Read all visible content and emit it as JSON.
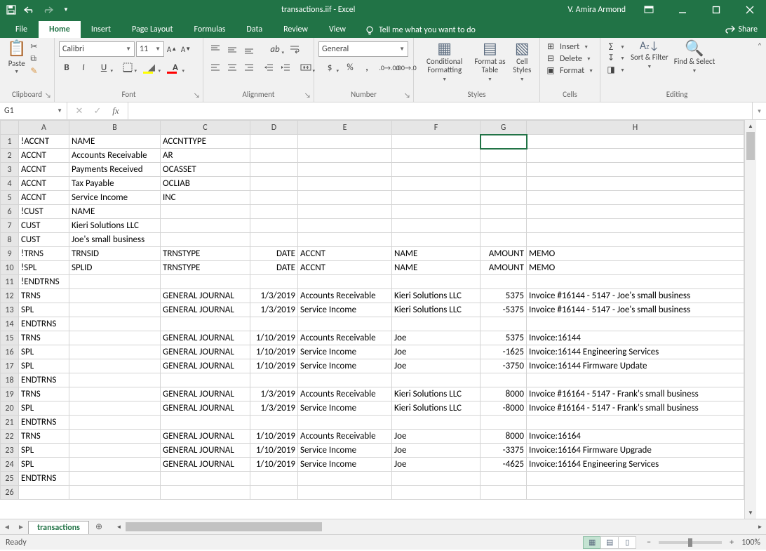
{
  "app": {
    "title": "transactions.iif  -  Excel",
    "user": "V. Amira Armond"
  },
  "tabs": {
    "file": "File",
    "home": "Home",
    "insert": "Insert",
    "page_layout": "Page Layout",
    "formulas": "Formulas",
    "data": "Data",
    "review": "Review",
    "view": "View",
    "tell": "Tell me what you want to do",
    "share": "Share"
  },
  "ribbon": {
    "clipboard": {
      "paste": "Paste",
      "label": "Clipboard"
    },
    "font": {
      "name": "Calibri",
      "size": "11",
      "label": "Font",
      "bold": "B",
      "italic": "I",
      "underline": "U"
    },
    "alignment": {
      "label": "Alignment",
      "wrap": "Wrap Text",
      "merge": "Merge & Center"
    },
    "number": {
      "format": "General",
      "label": "Number"
    },
    "styles": {
      "cond": "Conditional Formatting",
      "fast": "Format as Table",
      "cstyles": "Cell Styles",
      "label": "Styles"
    },
    "cells": {
      "insert": "Insert",
      "delete": "Delete",
      "format": "Format",
      "label": "Cells"
    },
    "editing": {
      "sort": "Sort & Filter",
      "find": "Find & Select",
      "label": "Editing"
    }
  },
  "namebox": "G1",
  "sheet_tab": "transactions",
  "status": {
    "ready": "Ready",
    "zoom": "100%"
  },
  "columns": [
    "A",
    "B",
    "C",
    "D",
    "E",
    "F",
    "G",
    "H"
  ],
  "rows": [
    {
      "n": 1,
      "A": "!ACCNT",
      "B": "NAME",
      "C": "ACCNTTYPE"
    },
    {
      "n": 2,
      "A": "ACCNT",
      "B": "Accounts Receivable",
      "C": "AR"
    },
    {
      "n": 3,
      "A": "ACCNT",
      "B": "Payments Received",
      "C": "OCASSET"
    },
    {
      "n": 4,
      "A": "ACCNT",
      "B": "Tax Payable",
      "C": "OCLIAB"
    },
    {
      "n": 5,
      "A": "ACCNT",
      "B": "Service Income",
      "C": "INC"
    },
    {
      "n": 6,
      "A": "!CUST",
      "B": "NAME"
    },
    {
      "n": 7,
      "A": "CUST",
      "B": "Kieri Solutions LLC"
    },
    {
      "n": 8,
      "A": "CUST",
      "B": "Joe's small business"
    },
    {
      "n": 9,
      "A": "!TRNS",
      "B": "TRNSID",
      "C": "TRNSTYPE",
      "D": "DATE",
      "E": "ACCNT",
      "F": "NAME",
      "G": "AMOUNT",
      "H": "MEMO"
    },
    {
      "n": 10,
      "A": "!SPL",
      "B": "SPLID",
      "C": "TRNSTYPE",
      "D": "DATE",
      "E": "ACCNT",
      "F": "NAME",
      "G": "AMOUNT",
      "H": "MEMO"
    },
    {
      "n": 11,
      "A": "!ENDTRNS"
    },
    {
      "n": 12,
      "A": "TRNS",
      "C": "GENERAL JOURNAL",
      "D": "1/3/2019",
      "E": "Accounts Receivable",
      "F": "Kieri Solutions LLC",
      "G": "5375",
      "H": "Invoice #16144 - 5147 - Joe's small business"
    },
    {
      "n": 13,
      "A": "SPL",
      "C": "GENERAL JOURNAL",
      "D": "1/3/2019",
      "E": "Service Income",
      "F": "Kieri Solutions LLC",
      "G": "-5375",
      "H": "Invoice #16144 - 5147 - Joe's small business"
    },
    {
      "n": 14,
      "A": "ENDTRNS"
    },
    {
      "n": 15,
      "A": "TRNS",
      "C": "GENERAL JOURNAL",
      "D": "1/10/2019",
      "E": "Accounts Receivable",
      "F": "Joe",
      "G": "5375",
      "H": "Invoice:16144"
    },
    {
      "n": 16,
      "A": "SPL",
      "C": "GENERAL JOURNAL",
      "D": "1/10/2019",
      "E": "Service Income",
      "F": "Joe",
      "G": "-1625",
      "H": "Invoice:16144  Engineering Services"
    },
    {
      "n": 17,
      "A": "SPL",
      "C": "GENERAL JOURNAL",
      "D": "1/10/2019",
      "E": "Service Income",
      "F": "Joe",
      "G": "-3750",
      "H": "Invoice:16144  Firmware Update"
    },
    {
      "n": 18,
      "A": "ENDTRNS"
    },
    {
      "n": 19,
      "A": "TRNS",
      "C": "GENERAL JOURNAL",
      "D": "1/3/2019",
      "E": "Accounts Receivable",
      "F": "Kieri Solutions LLC",
      "G": "8000",
      "H": "Invoice #16164 - 5147 - Frank's small business"
    },
    {
      "n": 20,
      "A": "SPL",
      "C": "GENERAL JOURNAL",
      "D": "1/3/2019",
      "E": "Service Income",
      "F": "Kieri Solutions LLC",
      "G": "-8000",
      "H": "Invoice #16164 - 5147 - Frank's small business"
    },
    {
      "n": 21,
      "A": "ENDTRNS"
    },
    {
      "n": 22,
      "A": "TRNS",
      "C": "GENERAL JOURNAL",
      "D": "1/10/2019",
      "E": "Accounts Receivable",
      "F": "Joe",
      "G": "8000",
      "H": "Invoice:16164"
    },
    {
      "n": 23,
      "A": "SPL",
      "C": "GENERAL JOURNAL",
      "D": "1/10/2019",
      "E": "Service Income",
      "F": "Joe",
      "G": "-3375",
      "H": "Invoice:16164  Firmware Upgrade"
    },
    {
      "n": 24,
      "A": "SPL",
      "C": "GENERAL JOURNAL",
      "D": "1/10/2019",
      "E": "Service Income",
      "F": "Joe",
      "G": "-4625",
      "H": "Invoice:16164  Engineering Services"
    },
    {
      "n": 25,
      "A": "ENDTRNS"
    },
    {
      "n": 26
    }
  ],
  "selected": {
    "col": "G",
    "row": 1
  }
}
